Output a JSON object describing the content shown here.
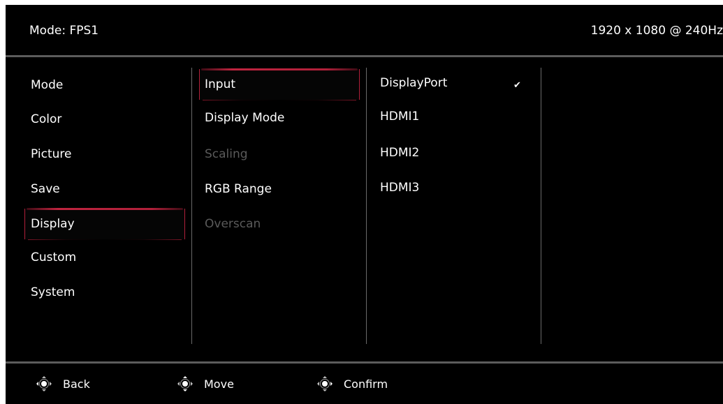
{
  "header": {
    "mode_label": "Mode: FPS1",
    "resolution": "1920 x 1080 @ 240Hz"
  },
  "menu": {
    "items": [
      {
        "label": "Mode",
        "selected": false
      },
      {
        "label": "Color",
        "selected": false
      },
      {
        "label": "Picture",
        "selected": false
      },
      {
        "label": "Save",
        "selected": false
      },
      {
        "label": "Display",
        "selected": true
      },
      {
        "label": "Custom",
        "selected": false
      },
      {
        "label": "System",
        "selected": false
      }
    ]
  },
  "submenu": {
    "items": [
      {
        "label": "Input",
        "selected": true,
        "enabled": true
      },
      {
        "label": "Display Mode",
        "selected": false,
        "enabled": true
      },
      {
        "label": "Scaling",
        "selected": false,
        "enabled": false
      },
      {
        "label": "RGB Range",
        "selected": false,
        "enabled": true
      },
      {
        "label": "Overscan",
        "selected": false,
        "enabled": false
      }
    ]
  },
  "options": {
    "items": [
      {
        "label": "DisplayPort",
        "checked": true
      },
      {
        "label": "HDMI1",
        "checked": false
      },
      {
        "label": "HDMI2",
        "checked": false
      },
      {
        "label": "HDMI3",
        "checked": false
      }
    ],
    "check_symbol": "✔"
  },
  "footer": {
    "back_label": "Back",
    "move_label": "Move",
    "confirm_label": "Confirm"
  },
  "colors": {
    "background": "#000000",
    "accent": "#b1203a",
    "text": "#ffffff",
    "disabled_text": "#5a5a5a",
    "divider": "#5c5c5c"
  },
  "icons": {
    "back": "nav-key-left-icon",
    "move": "nav-key-updown-icon",
    "confirm": "nav-key-right-icon"
  }
}
